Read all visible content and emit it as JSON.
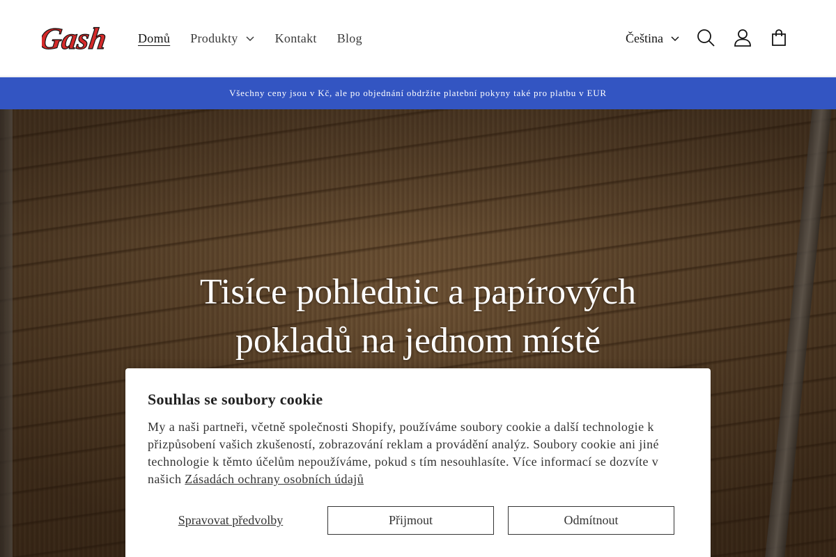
{
  "header": {
    "logo_text": "Gash",
    "nav": [
      {
        "label": "Domů",
        "active": true
      },
      {
        "label": "Produkty",
        "has_dropdown": true
      },
      {
        "label": "Kontakt"
      },
      {
        "label": "Blog"
      }
    ],
    "language": "Čeština",
    "icons": [
      "search-icon",
      "account-icon",
      "cart-icon"
    ]
  },
  "banner": {
    "text": "Všechny ceny jsou v Kč, ale po objednání obdržíte platební pokyny také pro platbu v EUR",
    "color": "#3355c2"
  },
  "hero": {
    "title_line1": "Tisíce pohlednic a papírových",
    "title_line2": "pokladů na jednom místě"
  },
  "cookie": {
    "title": "Souhlas se soubory cookie",
    "text": "My a naši partneři, včetně společnosti Shopify, používáme soubory cookie a další technologie k přizpůsobení vašich zkušeností, zobrazování reklam a provádění analýz. Soubory cookie ani jiné technologie k těmto účelům nepoužíváme, pokud s tím nesouhlasíte. Více informací se dozvíte v našich",
    "link": "Zásadách ochrany osobních údajů",
    "manage_label": "Spravovat předvolby",
    "accept_label": "Přijmout",
    "decline_label": "Odmítnout"
  },
  "colors": {
    "logo_red": "#d42a2a",
    "banner_blue": "#3355c2"
  }
}
